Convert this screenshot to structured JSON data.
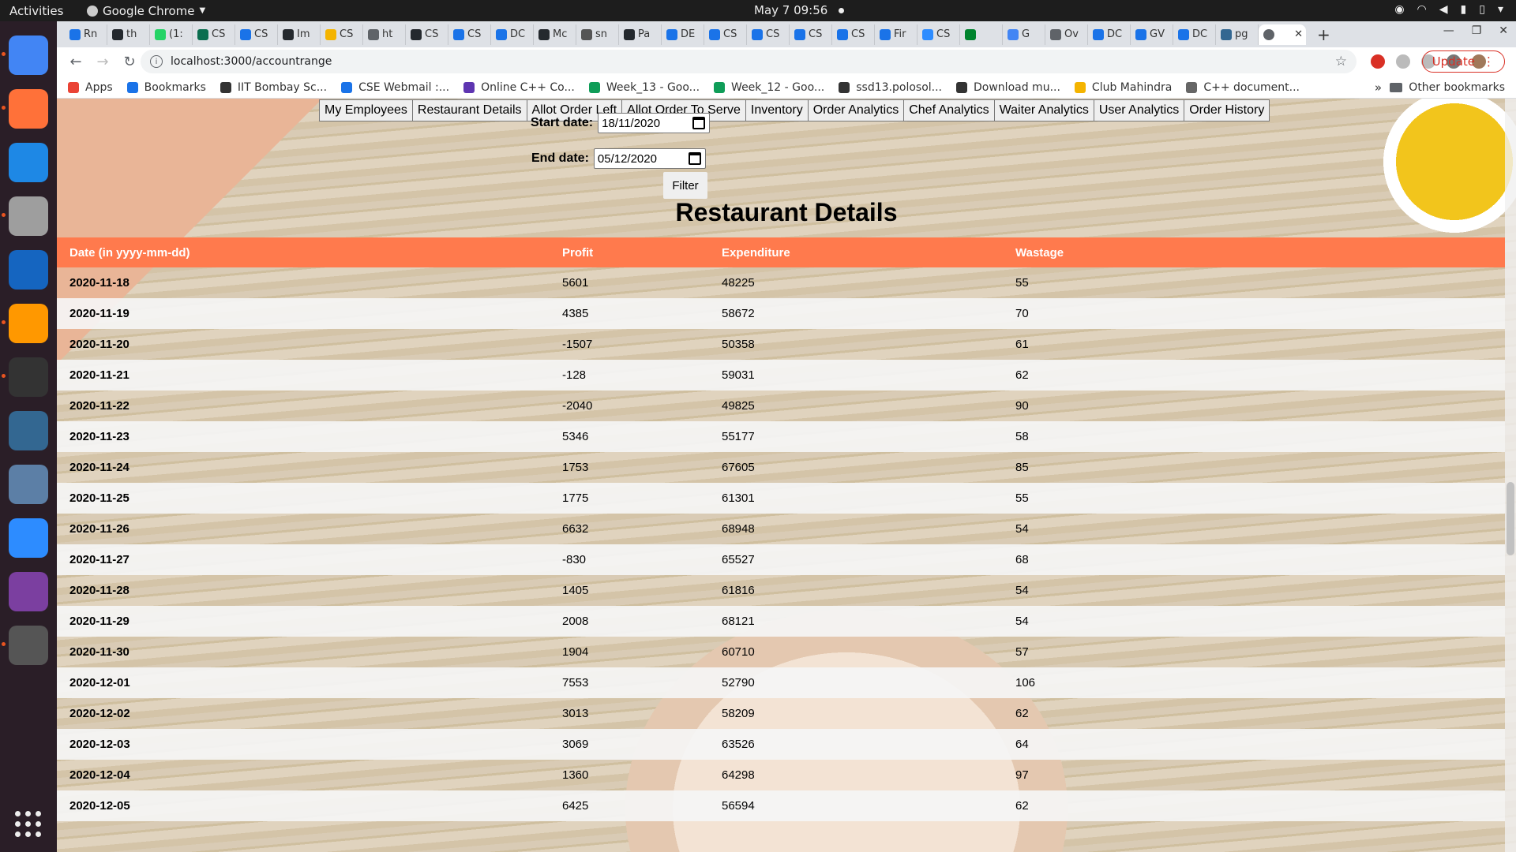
{
  "topbar": {
    "activities": "Activities",
    "app_name": "Google Chrome",
    "clock": "May 7  09:56"
  },
  "dock": {
    "apps": [
      {
        "name": "chrome",
        "color": "#4285f4"
      },
      {
        "name": "firefox",
        "color": "#ff7139"
      },
      {
        "name": "vscode",
        "color": "#1e88e5"
      },
      {
        "name": "files",
        "color": "#9e9e9e"
      },
      {
        "name": "writer",
        "color": "#1565c0"
      },
      {
        "name": "sublime",
        "color": "#ff9800"
      },
      {
        "name": "terminal",
        "color": "#333333"
      },
      {
        "name": "postgres",
        "color": "#336791"
      },
      {
        "name": "virtualbox",
        "color": "#5c7fa6"
      },
      {
        "name": "zoom",
        "color": "#2d8cff"
      },
      {
        "name": "screen-recorder",
        "color": "#7b3fa0"
      },
      {
        "name": "magnifier",
        "color": "#555555"
      }
    ]
  },
  "browser": {
    "tabs": [
      {
        "label": "Rn",
        "color": "#1a73e8"
      },
      {
        "label": "th",
        "color": "#24292e"
      },
      {
        "label": "(1:",
        "color": "#25d366"
      },
      {
        "label": "CS",
        "color": "#0b6e4f"
      },
      {
        "label": "CS",
        "color": "#1a73e8"
      },
      {
        "label": "Im",
        "color": "#24292e"
      },
      {
        "label": "CS",
        "color": "#f4b400"
      },
      {
        "label": "ht",
        "color": "#5f6368"
      },
      {
        "label": "CS",
        "color": "#24292e"
      },
      {
        "label": "CS",
        "color": "#1a73e8"
      },
      {
        "label": "DC",
        "color": "#1a73e8"
      },
      {
        "label": "Mc",
        "color": "#24292e"
      },
      {
        "label": "sn",
        "color": "#555555"
      },
      {
        "label": "Pa",
        "color": "#24292e"
      },
      {
        "label": "DE",
        "color": "#1a73e8"
      },
      {
        "label": "CS",
        "color": "#1a73e8"
      },
      {
        "label": "CS",
        "color": "#1a73e8"
      },
      {
        "label": "CS",
        "color": "#1a73e8"
      },
      {
        "label": "CS",
        "color": "#1a73e8"
      },
      {
        "label": "Fir",
        "color": "#1a73e8"
      },
      {
        "label": "CS",
        "color": "#2d8cff"
      },
      {
        "label": "",
        "color": "#00832d"
      },
      {
        "label": "G",
        "color": "#4285f4"
      },
      {
        "label": "Ov",
        "color": "#5f6368"
      },
      {
        "label": "DC",
        "color": "#1a73e8"
      },
      {
        "label": "GV",
        "color": "#1a73e8"
      },
      {
        "label": "DC",
        "color": "#1a73e8"
      },
      {
        "label": "pg",
        "color": "#336791"
      }
    ],
    "active_tab": {
      "label": "",
      "color": "#5f6368"
    },
    "url": "localhost:3000/accountrange",
    "update_label": "Update",
    "bookmarks": [
      {
        "label": "Apps",
        "color": "#ea4335"
      },
      {
        "label": "Bookmarks",
        "color": "#1a73e8"
      },
      {
        "label": "IIT Bombay Sc...",
        "color": "#333333"
      },
      {
        "label": "CSE Webmail :...",
        "color": "#1a73e8"
      },
      {
        "label": "Online C++ Co...",
        "color": "#5e35b1"
      },
      {
        "label": "Week_13 - Goo...",
        "color": "#0f9d58"
      },
      {
        "label": "Week_12 - Goo...",
        "color": "#0f9d58"
      },
      {
        "label": "ssd13.polosol...",
        "color": "#333333"
      },
      {
        "label": "Download mu...",
        "color": "#333333"
      },
      {
        "label": "Club Mahindra",
        "color": "#f4b400"
      },
      {
        "label": "C++ document...",
        "color": "#666666"
      }
    ],
    "bookmarks_more": "»",
    "other_bookmarks": "Other bookmarks"
  },
  "page": {
    "nav_buttons": [
      "My Employees",
      "Restaurant Details",
      "Allot Order Left",
      "Allot Order To Serve",
      "Inventory",
      "Order Analytics",
      "Chef Analytics",
      "Waiter Analytics",
      "User Analytics",
      "Order History"
    ],
    "start_label": "Start date:",
    "start_value": "18/11/2020",
    "end_label": "End date:",
    "end_value": "05/12/2020",
    "filter_label": "Filter",
    "title": "Restaurant Details",
    "table": {
      "columns": [
        "Date (in yyyy-mm-dd)",
        "Profit",
        "Expenditure",
        "Wastage"
      ],
      "rows": [
        [
          "2020-11-18",
          "5601",
          "48225",
          "55"
        ],
        [
          "2020-11-19",
          "4385",
          "58672",
          "70"
        ],
        [
          "2020-11-20",
          "-1507",
          "50358",
          "61"
        ],
        [
          "2020-11-21",
          "-128",
          "59031",
          "62"
        ],
        [
          "2020-11-22",
          "-2040",
          "49825",
          "90"
        ],
        [
          "2020-11-23",
          "5346",
          "55177",
          "58"
        ],
        [
          "2020-11-24",
          "1753",
          "67605",
          "85"
        ],
        [
          "2020-11-25",
          "1775",
          "61301",
          "55"
        ],
        [
          "2020-11-26",
          "6632",
          "68948",
          "54"
        ],
        [
          "2020-11-27",
          "-830",
          "65527",
          "68"
        ],
        [
          "2020-11-28",
          "1405",
          "61816",
          "54"
        ],
        [
          "2020-11-29",
          "2008",
          "68121",
          "54"
        ],
        [
          "2020-11-30",
          "1904",
          "60710",
          "57"
        ],
        [
          "2020-12-01",
          "7553",
          "52790",
          "106"
        ],
        [
          "2020-12-02",
          "3013",
          "58209",
          "62"
        ],
        [
          "2020-12-03",
          "3069",
          "63526",
          "64"
        ],
        [
          "2020-12-04",
          "1360",
          "64298",
          "97"
        ],
        [
          "2020-12-05",
          "6425",
          "56594",
          "62"
        ]
      ]
    },
    "header_color": "#ff7a4d"
  }
}
